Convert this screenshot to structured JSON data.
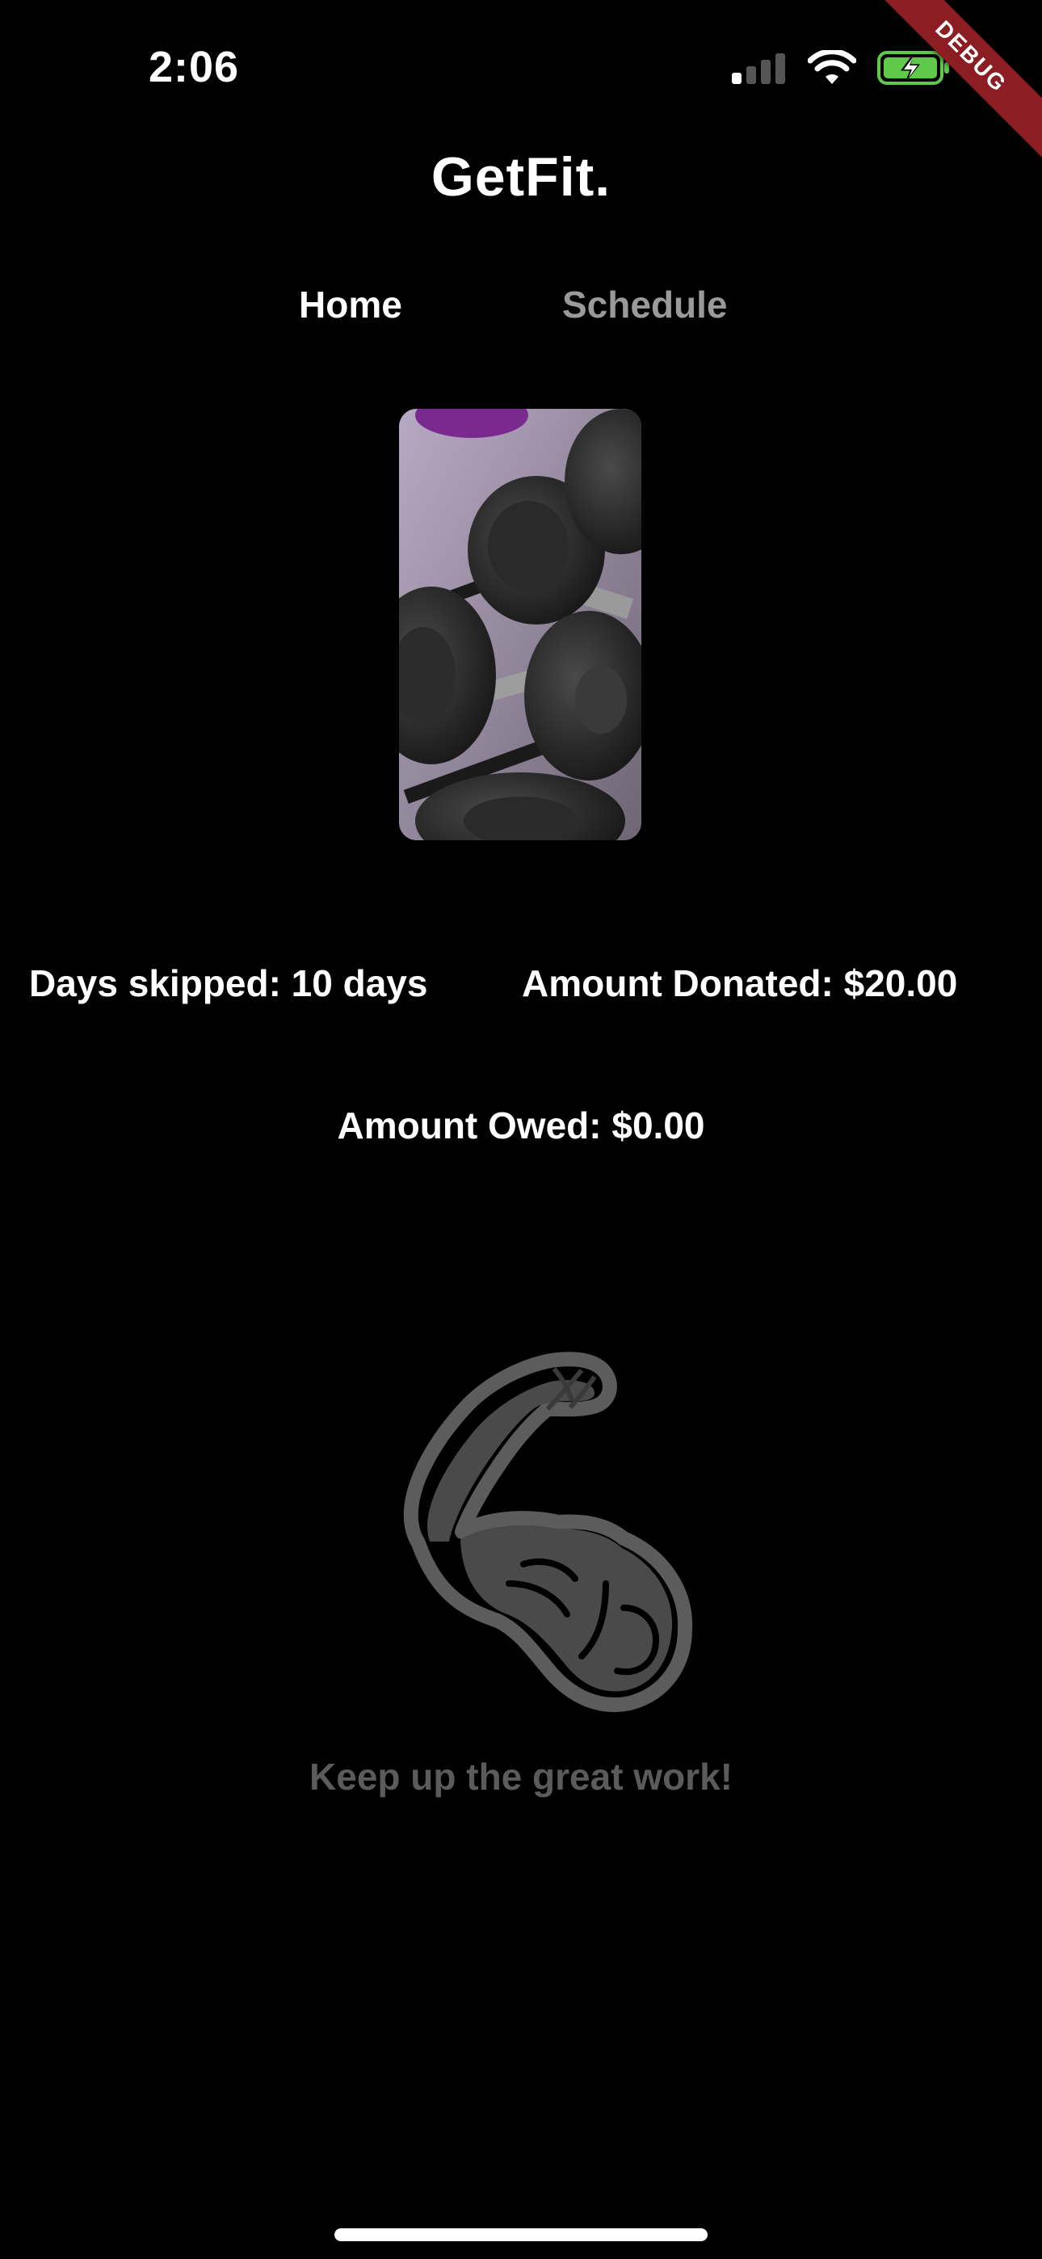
{
  "status_bar": {
    "time": "2:06"
  },
  "debug_banner": "DEBUG",
  "app": {
    "title": "GetFit."
  },
  "tabs": [
    {
      "label": "Home",
      "active": true
    },
    {
      "label": "Schedule",
      "active": false
    }
  ],
  "stats": {
    "days_skipped": "Days skipped: 10 days",
    "amount_donated": "Amount Donated: $20.00",
    "amount_owed": "Amount Owed: $0.00"
  },
  "message": "Keep up the great work!",
  "icons": {
    "signal": "cellular-signal-icon",
    "wifi": "wifi-icon",
    "battery": "battery-charging-icon",
    "illustration": "flexed-arm-icon"
  },
  "colors": {
    "background": "#000000",
    "inactive_tab": "#9a9a9a",
    "muted_text": "#5b5b5b",
    "battery_green": "#5fc94a",
    "debug_red": "#8b1d23"
  }
}
